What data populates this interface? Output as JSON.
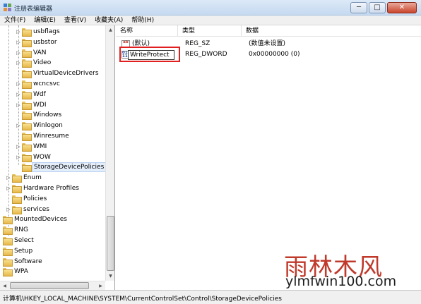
{
  "window": {
    "title": "注册表编辑器",
    "minimize_glyph": "─",
    "maximize_glyph": "□",
    "close_glyph": "✕"
  },
  "menu": [
    "文件(F)",
    "编辑(E)",
    "查看(V)",
    "收藏夹(A)",
    "帮助(H)"
  ],
  "tree": {
    "items": [
      {
        "label": "usbflags",
        "level": 2,
        "expander": "▷"
      },
      {
        "label": "usbstor",
        "level": 2,
        "expander": "▷"
      },
      {
        "label": "VAN",
        "level": 2,
        "expander": "▷"
      },
      {
        "label": "Video",
        "level": 2,
        "expander": "▷"
      },
      {
        "label": "VirtualDeviceDrivers",
        "level": 2,
        "expander": ""
      },
      {
        "label": "wcncsvc",
        "level": 2,
        "expander": "▷"
      },
      {
        "label": "Wdf",
        "level": 2,
        "expander": "▷"
      },
      {
        "label": "WDI",
        "level": 2,
        "expander": "▷"
      },
      {
        "label": "Windows",
        "level": 2,
        "expander": ""
      },
      {
        "label": "Winlogon",
        "level": 2,
        "expander": "▷"
      },
      {
        "label": "Winresume",
        "level": 2,
        "expander": ""
      },
      {
        "label": "WMI",
        "level": 2,
        "expander": "▷"
      },
      {
        "label": "WOW",
        "level": 2,
        "expander": "▷"
      },
      {
        "label": "StorageDevicePolicies",
        "level": 2,
        "expander": "",
        "selected": true
      },
      {
        "label": "Enum",
        "level": 1,
        "expander": "▷"
      },
      {
        "label": "Hardware Profiles",
        "level": 1,
        "expander": "▷"
      },
      {
        "label": "Policies",
        "level": 1,
        "expander": ""
      },
      {
        "label": "services",
        "level": 1,
        "expander": "▷"
      },
      {
        "label": "MountedDevices",
        "level": 0,
        "expander": ""
      },
      {
        "label": "RNG",
        "level": 0,
        "expander": ""
      },
      {
        "label": "Select",
        "level": 0,
        "expander": ""
      },
      {
        "label": "Setup",
        "level": 0,
        "expander": ""
      },
      {
        "label": "Software",
        "level": 0,
        "expander": ""
      },
      {
        "label": "WPA",
        "level": 0,
        "expander": ""
      }
    ],
    "scroll_up_arrow": "▲",
    "scroll_down_arrow": "▼",
    "scroll_left_arrow": "◀",
    "scroll_right_arrow": "▶"
  },
  "list": {
    "columns": [
      "名称",
      "类型",
      "数据"
    ],
    "rows": [
      {
        "icon": "string-value-icon",
        "icon_text": "ab",
        "name": "(默认)",
        "type": "REG_SZ",
        "data": "(数值未设置)"
      },
      {
        "icon": "dword-value-icon",
        "icon_text": "011\n110",
        "name": "WriteProtect",
        "type": "REG_DWORD",
        "data": "0x00000000 (0)",
        "editing": true
      }
    ]
  },
  "status": {
    "path": "计算机\\HKEY_LOCAL_MACHINE\\SYSTEM\\CurrentControlSet\\Control\\StorageDevicePolicies"
  },
  "watermark": {
    "cn": "雨林木风",
    "url": "ylmfwin100.com"
  },
  "colors": {
    "highlight": "#e02020",
    "watermark_red": "#c0392b",
    "folder_yellow": "#f3cf6b"
  }
}
